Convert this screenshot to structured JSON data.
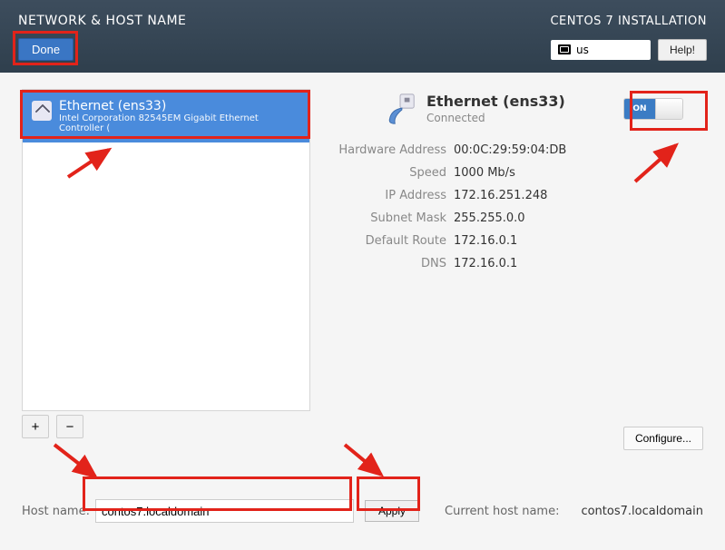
{
  "header": {
    "page_title": "NETWORK & HOST NAME",
    "installer_title": "CENTOS 7 INSTALLATION",
    "done_label": "Done",
    "keyboard_layout": "us",
    "help_label": "Help!"
  },
  "sidebar": {
    "nics": [
      {
        "name": "Ethernet (ens33)",
        "description": "Intel Corporation 82545EM Gigabit Ethernet Controller ("
      }
    ],
    "add_label": "+",
    "remove_label": "−"
  },
  "details": {
    "header_name": "Ethernet (ens33)",
    "header_status": "Connected",
    "toggle_state": "ON",
    "fields": {
      "hardware_address_label": "Hardware Address",
      "hardware_address": "00:0C:29:59:04:DB",
      "speed_label": "Speed",
      "speed": "1000 Mb/s",
      "ip_label": "IP Address",
      "ip": "172.16.251.248",
      "subnet_label": "Subnet Mask",
      "subnet": "255.255.0.0",
      "gateway_label": "Default Route",
      "gateway": "172.16.0.1",
      "dns_label": "DNS",
      "dns": "172.16.0.1"
    },
    "configure_label": "Configure..."
  },
  "footer": {
    "hostname_label": "Host name:",
    "hostname_value": "contos7.localdomain",
    "apply_label": "Apply",
    "current_hostname_label": "Current host name:",
    "current_hostname_value": "contos7.localdomain"
  }
}
